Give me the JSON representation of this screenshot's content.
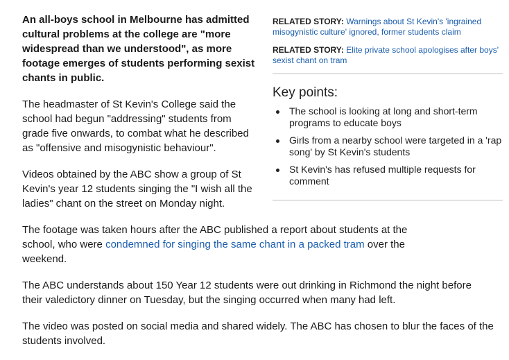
{
  "article": {
    "lead": "An all-boys school in Melbourne has admitted cultural problems at the college are \"more widespread than we understood\", as more footage emerges of students performing sexist chants in public.",
    "p1": "The headmaster of St Kevin's College said the school had begun \"addressing\" students from grade five onwards, to combat what he described as \"offensive and misogynistic behaviour\".",
    "p2": "Videos obtained by the ABC show a group of St Kevin's year 12 students singing the \"I wish all the ladies\" chant on the street on Monday night.",
    "p3_before": "The footage was taken hours after the ABC published a report about students at the school, who were ",
    "p3_link": "condemned for singing the same chant in a packed tram",
    "p3_after": " over the weekend.",
    "p4": "The ABC understands about 150 Year 12 students were out drinking in Richmond the night before their valedictory dinner on Tuesday, but the singing occurred when many had left.",
    "p5": "The video was posted on social media and shared widely. The ABC has chosen to blur the faces of the students involved."
  },
  "sidebar": {
    "related": [
      {
        "label": "RELATED STORY:",
        "link": "Warnings about St Kevin's 'ingrained misogynistic culture' ignored, former students claim"
      },
      {
        "label": "RELATED STORY:",
        "link": "Elite private school apologises after boys' sexist chant on tram"
      }
    ],
    "key_points_title": "Key points:",
    "key_points": [
      "The school is looking at long and short-term programs to educate boys",
      "Girls from a nearby school were targeted in a 'rap song' by St Kevin's students",
      "St Kevin's has refused multiple requests for comment"
    ]
  },
  "colors": {
    "link": "#1a5dad",
    "text": "#1a1a1a",
    "divider": "#bdbdbd"
  }
}
